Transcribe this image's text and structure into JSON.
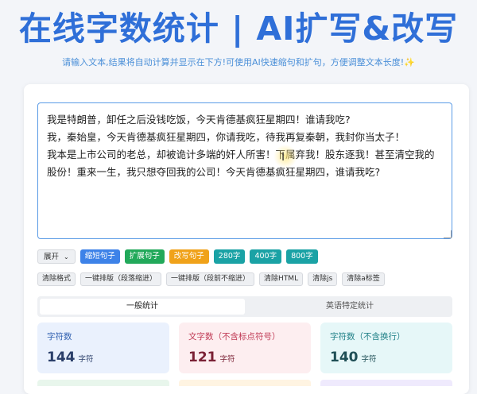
{
  "header": {
    "title": "在线字数统计 | AI扩写&改写",
    "subtitle": "请输入文本,结果将自动计算并显示在下方!可使用AI快速缩句和扩句，方便调整文本长度!✨"
  },
  "editor": {
    "lines": [
      "我是特朗普，卸任之后没钱吃饭，今天肯德基疯狂星期四！谁请我吃?",
      "",
      "我，秦始皇，今天肯德基疯狂星期四，你请我吃，待我再复秦朝，我封你当太子！",
      "",
      "我本是上市公司的老总，却被诡计多端的奸人所害！下属弃我！股东逐我！甚至清空我的股份！重来一生，我只想夺回我的公司！今天肯德基疯狂星期四，谁请我吃?"
    ]
  },
  "toolbar": {
    "expand": "展开",
    "expand_icon": "chevron-down-icon",
    "shorten": "缩短句子",
    "expand_sentence": "扩展句子",
    "rewrite": "改写句子",
    "w280": "280字",
    "w400": "400字",
    "w800": "800字"
  },
  "format": {
    "clear": "清除格式",
    "layout_indent": "一键排版（段落缩进）",
    "layout_noindent": "一键排版（段前不缩进）",
    "clear_html": "清除HTML",
    "clear_js": "清除js",
    "clear_a": "清除a标签"
  },
  "tabs": {
    "general": "一般统计",
    "english": "英语特定统计"
  },
  "stats": [
    {
      "label": "字符数",
      "value": "144",
      "unit": "字符"
    },
    {
      "label": "文字数（不含标点符号）",
      "value": "121",
      "unit": "字符"
    },
    {
      "label": "字符数（不含换行）",
      "value": "140",
      "unit": "字符"
    }
  ],
  "colors": {
    "accent": "#2f6fd8",
    "blue": "#3d82e8",
    "green": "#22a95a",
    "orange": "#f0a21a",
    "teal": "#1aa2a5"
  }
}
